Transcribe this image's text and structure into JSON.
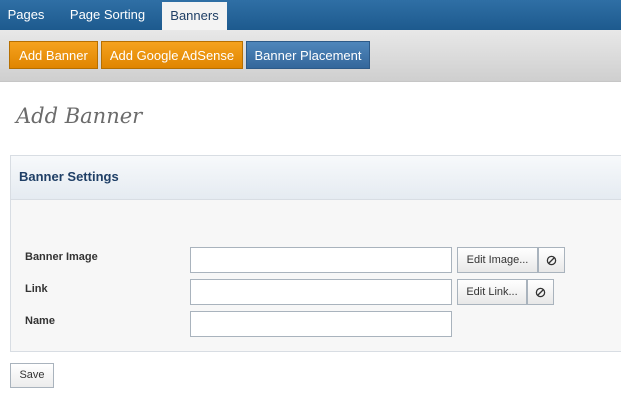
{
  "tabs": [
    {
      "label": "Pages"
    },
    {
      "label": "Page Sorting"
    },
    {
      "label": "Banners"
    }
  ],
  "toolbar": {
    "add_banner": "Add Banner",
    "add_adsense": "Add Google AdSense",
    "banner_placement": "Banner Placement"
  },
  "page_title": "Add Banner",
  "panel": {
    "title": "Banner Settings",
    "fields": {
      "banner_image": {
        "label": "Banner Image",
        "value": "",
        "button": "Edit Image...",
        "clear_icon": "clear-icon"
      },
      "link": {
        "label": "Link",
        "value": "",
        "button": "Edit Link...",
        "clear_icon": "clear-icon"
      },
      "name": {
        "label": "Name",
        "value": ""
      }
    }
  },
  "save_label": "Save",
  "colors": {
    "topbar": "#1d5a8e",
    "orange_button": "#f0950e",
    "blue_button": "#34679b",
    "title_text": "#1f3f66"
  }
}
